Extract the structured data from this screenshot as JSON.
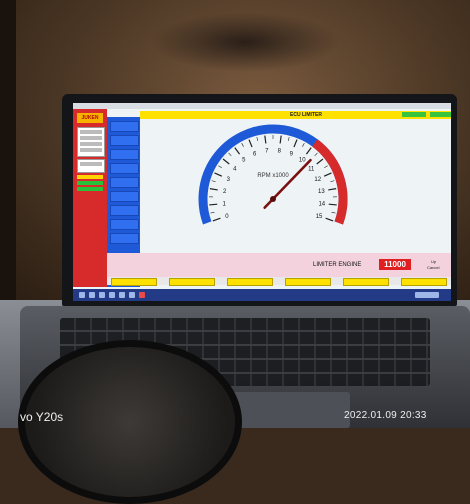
{
  "app": {
    "logo_text": "JUKEN",
    "window_title": "ECU LIMITER"
  },
  "gauge": {
    "label": "RPM x1000",
    "ticks": [
      "0",
      "1",
      "2",
      "3",
      "4",
      "5",
      "6",
      "7",
      "8",
      "9",
      "10",
      "11",
      "12",
      "13",
      "14",
      "15"
    ],
    "needle_value": 10.5,
    "max": 15,
    "redline_start": 10
  },
  "limiter": {
    "label": "LIMITER ENGINE",
    "value": "11000",
    "up_label": "Up",
    "cancel_label": "Cancel"
  },
  "photo": {
    "watermark_device": "vo Y20s",
    "watermark_datetime": "2022.01.09 20:33"
  },
  "colors": {
    "accent_red": "#d72a2a",
    "accent_blue": "#1e5ad8",
    "accent_yellow": "#ffe100",
    "limiter_box": "#e02020"
  }
}
